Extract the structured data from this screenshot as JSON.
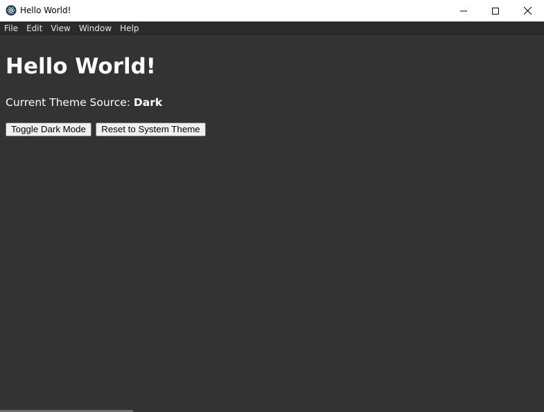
{
  "window": {
    "title": "Hello World!",
    "icon": "electron-icon",
    "controls": [
      "minimize-icon",
      "maximize-icon",
      "close-icon"
    ]
  },
  "menu": {
    "items": [
      "File",
      "Edit",
      "View",
      "Window",
      "Help"
    ]
  },
  "main": {
    "heading": "Hello World!",
    "theme_label": "Current Theme Source: ",
    "theme_value": "Dark",
    "buttons": {
      "toggle": "Toggle Dark Mode",
      "reset": "Reset to System Theme"
    }
  },
  "colors": {
    "background": "#333333",
    "menubar": "#2b2b2b",
    "titlebar": "#ffffff",
    "text": "#ffffff"
  }
}
